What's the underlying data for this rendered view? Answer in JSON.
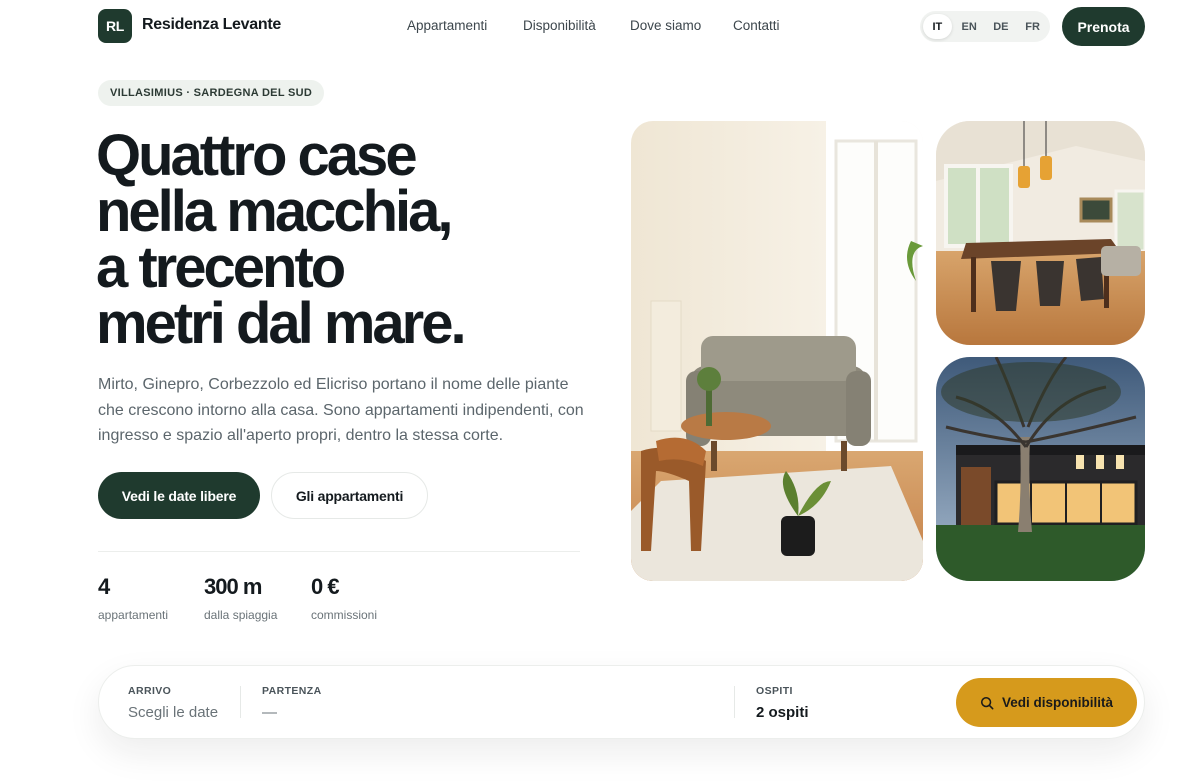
{
  "brand": {
    "logo_initials": "RL",
    "name": "Residenza Levante",
    "primary_color": "#1f3a2e",
    "accent_color": "#d69a1c"
  },
  "nav": {
    "items": [
      "Appartamenti",
      "Disponibilità",
      "Dove siamo",
      "Contatti"
    ]
  },
  "languages": {
    "options": [
      "IT",
      "EN",
      "DE",
      "FR"
    ],
    "selected": "IT"
  },
  "header_cta": "Prenota",
  "hero": {
    "eyebrow": "VILLASIMIUS · SARDEGNA DEL SUD",
    "headline": [
      "Quattro case",
      "nella macchia,",
      "a trecento",
      "metri dal mare."
    ],
    "lead": "Mirto, Ginepro, Corbezzolo ed Elicriso portano il nome delle piante che crescono intorno alla casa. Sono appartamenti indipendenti, con ingresso e spazio all'aperto propri, dentro la stessa corte.",
    "primary_button": "Vedi le date libere",
    "secondary_button": "Gli appartamenti",
    "stats": [
      {
        "value": "4",
        "label": "appartamenti"
      },
      {
        "value": "300 m",
        "label": "dalla spiaggia"
      },
      {
        "value": "0 €",
        "label": "commissioni"
      }
    ]
  },
  "gallery": [
    {
      "icon": "living-room-photo"
    },
    {
      "icon": "dining-room-photo"
    },
    {
      "icon": "house-exterior-photo"
    }
  ],
  "booking": {
    "arrival": {
      "label": "ARRIVO",
      "value": "Scegli le date"
    },
    "departure": {
      "label": "PARTENZA",
      "value": "—"
    },
    "guests": {
      "label": "OSPITI",
      "value": "2 ospiti"
    },
    "button": "Vedi disponibilità",
    "button_icon": "search-icon"
  }
}
